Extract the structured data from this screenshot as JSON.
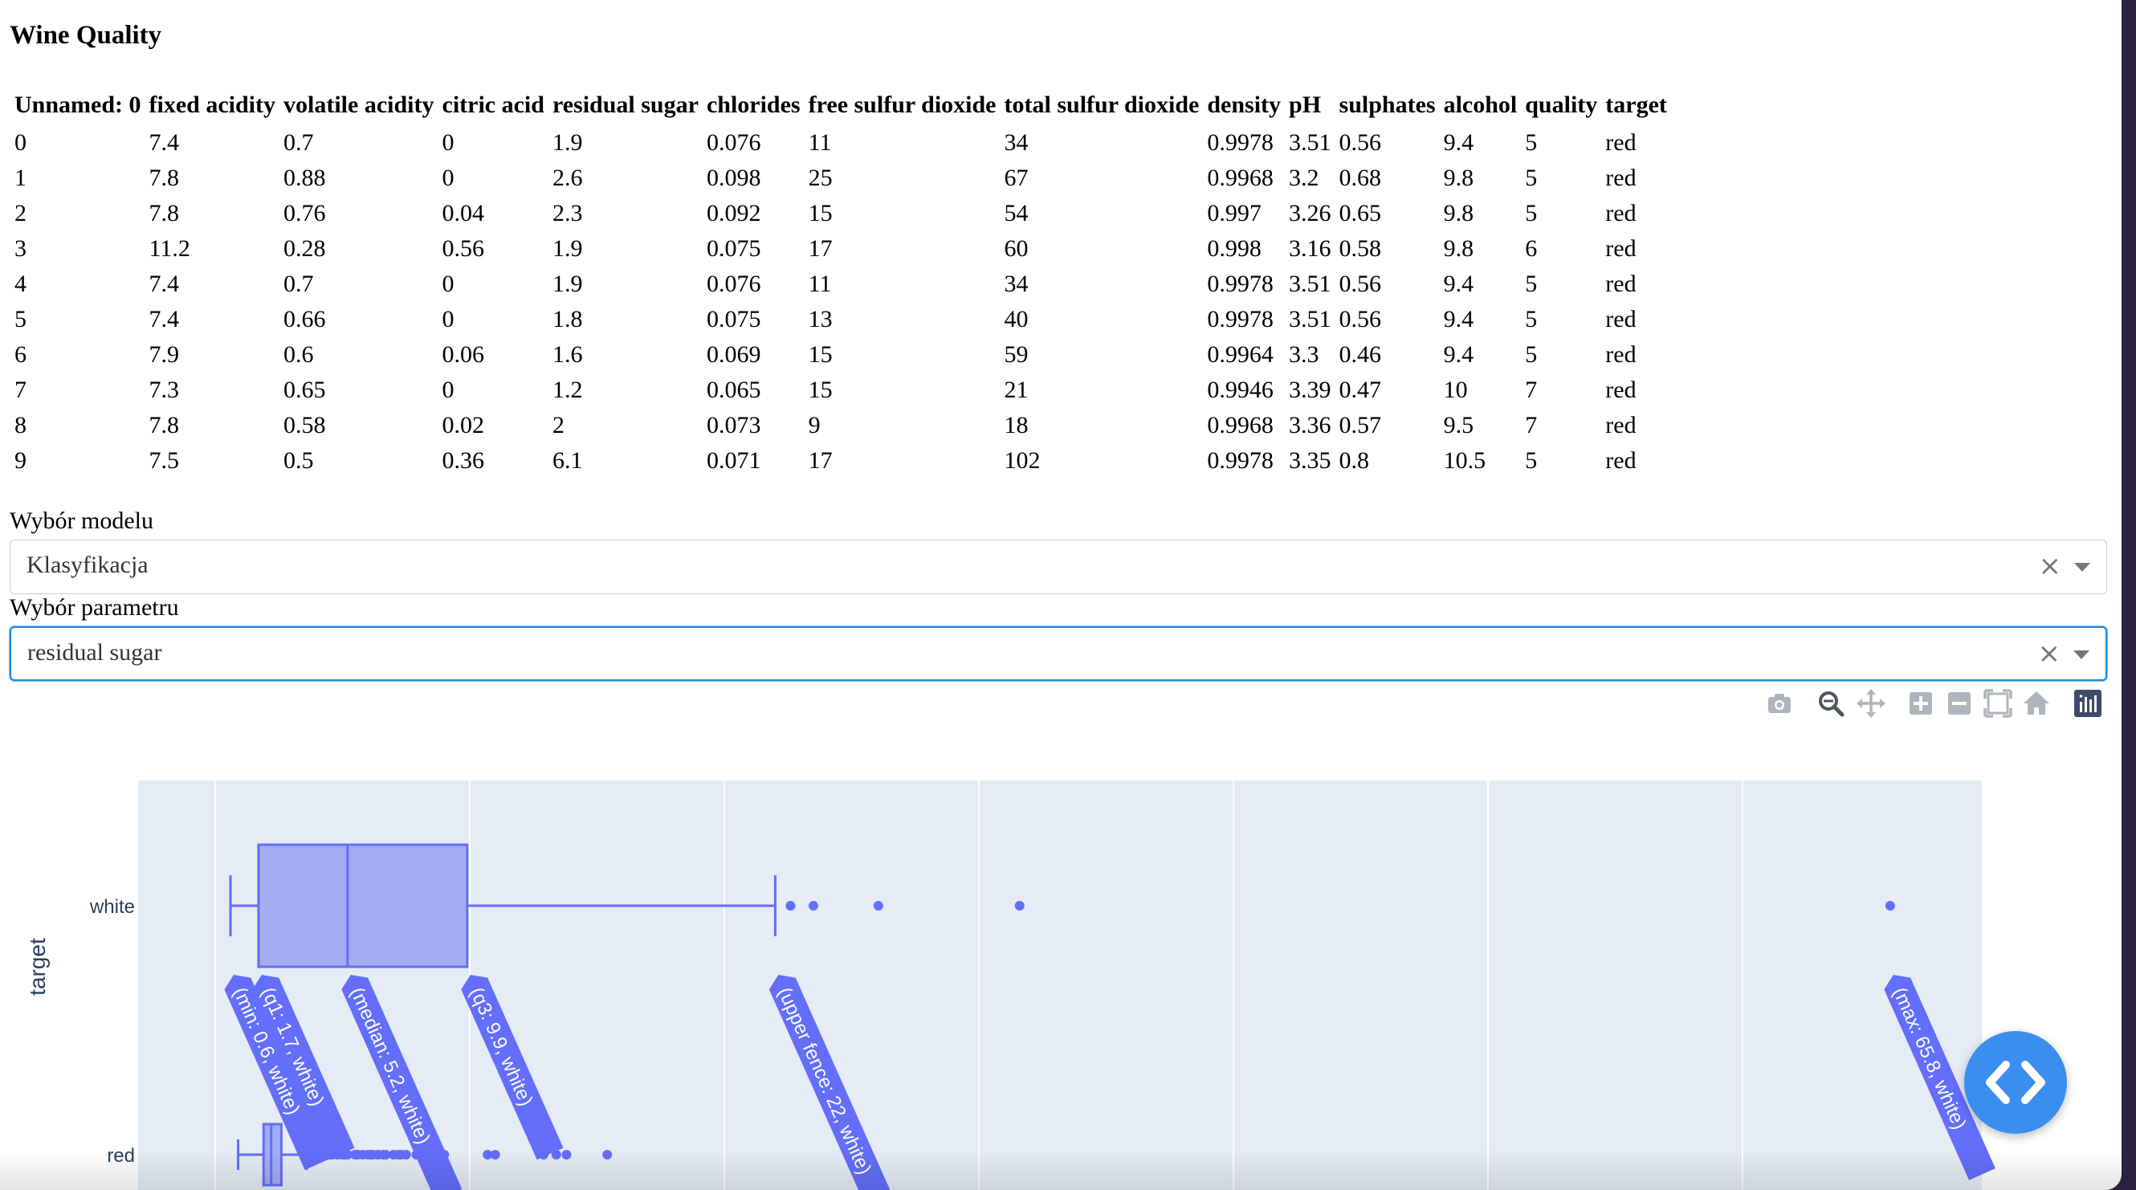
{
  "page": {
    "title": "Wine Quality"
  },
  "table": {
    "columns": [
      "Unnamed: 0",
      "fixed acidity",
      "volatile acidity",
      "citric acid",
      "residual sugar",
      "chlorides",
      "free sulfur dioxide",
      "total sulfur dioxide",
      "density",
      "pH",
      "sulphates",
      "alcohol",
      "quality",
      "target"
    ],
    "rows": [
      [
        "0",
        "7.4",
        "0.7",
        "0",
        "1.9",
        "0.076",
        "11",
        "34",
        "0.9978",
        "3.51",
        "0.56",
        "9.4",
        "5",
        "red"
      ],
      [
        "1",
        "7.8",
        "0.88",
        "0",
        "2.6",
        "0.098",
        "25",
        "67",
        "0.9968",
        "3.2",
        "0.68",
        "9.8",
        "5",
        "red"
      ],
      [
        "2",
        "7.8",
        "0.76",
        "0.04",
        "2.3",
        "0.092",
        "15",
        "54",
        "0.997",
        "3.26",
        "0.65",
        "9.8",
        "5",
        "red"
      ],
      [
        "3",
        "11.2",
        "0.28",
        "0.56",
        "1.9",
        "0.075",
        "17",
        "60",
        "0.998",
        "3.16",
        "0.58",
        "9.8",
        "6",
        "red"
      ],
      [
        "4",
        "7.4",
        "0.7",
        "0",
        "1.9",
        "0.076",
        "11",
        "34",
        "0.9978",
        "3.51",
        "0.56",
        "9.4",
        "5",
        "red"
      ],
      [
        "5",
        "7.4",
        "0.66",
        "0",
        "1.8",
        "0.075",
        "13",
        "40",
        "0.9978",
        "3.51",
        "0.56",
        "9.4",
        "5",
        "red"
      ],
      [
        "6",
        "7.9",
        "0.6",
        "0.06",
        "1.6",
        "0.069",
        "15",
        "59",
        "0.9964",
        "3.3",
        "0.46",
        "9.4",
        "5",
        "red"
      ],
      [
        "7",
        "7.3",
        "0.65",
        "0",
        "1.2",
        "0.065",
        "15",
        "21",
        "0.9946",
        "3.39",
        "0.47",
        "10",
        "7",
        "red"
      ],
      [
        "8",
        "7.8",
        "0.58",
        "0.02",
        "2",
        "0.073",
        "9",
        "18",
        "0.9968",
        "3.36",
        "0.57",
        "9.5",
        "7",
        "red"
      ],
      [
        "9",
        "7.5",
        "0.5",
        "0.36",
        "6.1",
        "0.071",
        "17",
        "102",
        "0.9978",
        "3.35",
        "0.8",
        "10.5",
        "5",
        "red"
      ]
    ]
  },
  "model_select": {
    "label": "Wybór modelu",
    "value": "Klasyfikacja",
    "clear_glyph": "×"
  },
  "param_select": {
    "label": "Wybór parametru",
    "value": "residual sugar",
    "clear_glyph": "×"
  },
  "modebar": {
    "icons": [
      "camera-icon",
      "zoom-icon",
      "pan-icon",
      "zoom-in-icon",
      "zoom-out-icon",
      "autoscale-icon",
      "reset-axes-icon",
      "plotly-logo-icon"
    ]
  },
  "chart_data": {
    "type": "box",
    "orientation": "horizontal",
    "ylabel": "target",
    "xlabel": "",
    "categories": [
      "white",
      "red"
    ],
    "xlim": [
      -1,
      72
    ],
    "grid": true,
    "colors": {
      "box_fill": "#a4adf1",
      "box_line": "#636efa",
      "plot_bg": "#e5ecf6",
      "hover_bg": "#636efa"
    },
    "series": [
      {
        "category": "white",
        "min": 0.6,
        "q1": 1.7,
        "median": 5.2,
        "q3": 9.9,
        "upper_fence": 22,
        "max": 65.8,
        "outliers": [
          22.6,
          23.5,
          26.05,
          31.6,
          65.8
        ]
      },
      {
        "category": "red",
        "min": 0.9,
        "q1": 1.9,
        "median": 2.2,
        "q3": 2.6,
        "upper_fence": 3.6,
        "outliers": [
          3.7,
          3.9,
          4.0,
          4.2,
          4.3,
          4.5,
          4.6,
          4.8,
          5.0,
          5.1,
          5.2,
          5.5,
          5.6,
          5.8,
          6.0,
          6.1,
          6.2,
          6.4,
          6.6,
          6.7,
          7.0,
          7.2,
          7.3,
          7.5,
          7.9,
          8.1,
          8.3,
          8.6,
          8.8,
          9.0,
          10.7,
          11.0,
          12.9,
          13.4,
          13.8,
          15.4
        ]
      }
    ],
    "hover_labels": [
      {
        "text": "(min: 0.6, white)",
        "value": 0.6
      },
      {
        "text": "(q1: 1.7, white)",
        "value": 1.7
      },
      {
        "text": "(median: 5.2, white)",
        "value": 5.2
      },
      {
        "text": "(q3: 9.9, white)",
        "value": 9.9
      },
      {
        "text": "(upper fence: 22, white)",
        "value": 22
      },
      {
        "text": "(max: 65.8, white)",
        "value": 65.8
      }
    ]
  }
}
